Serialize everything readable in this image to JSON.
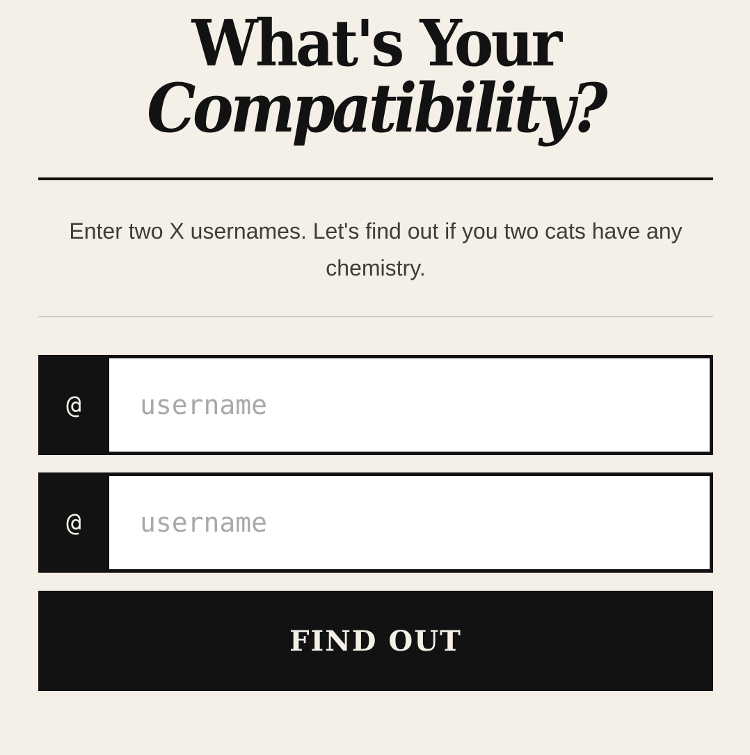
{
  "header": {
    "title_line1": "What's Your",
    "title_line2": "Compatibility?"
  },
  "intro": {
    "text": "Enter two X usernames. Let's find out if you two cats have any chemistry."
  },
  "form": {
    "fields": [
      {
        "prefix": "@",
        "placeholder": "username",
        "value": ""
      },
      {
        "prefix": "@",
        "placeholder": "username",
        "value": ""
      }
    ],
    "submit_label": "FIND OUT"
  },
  "colors": {
    "background": "#f4f0e8",
    "ink": "#121212",
    "muted_text": "#3d3d3a",
    "placeholder": "#a9a9a6"
  }
}
